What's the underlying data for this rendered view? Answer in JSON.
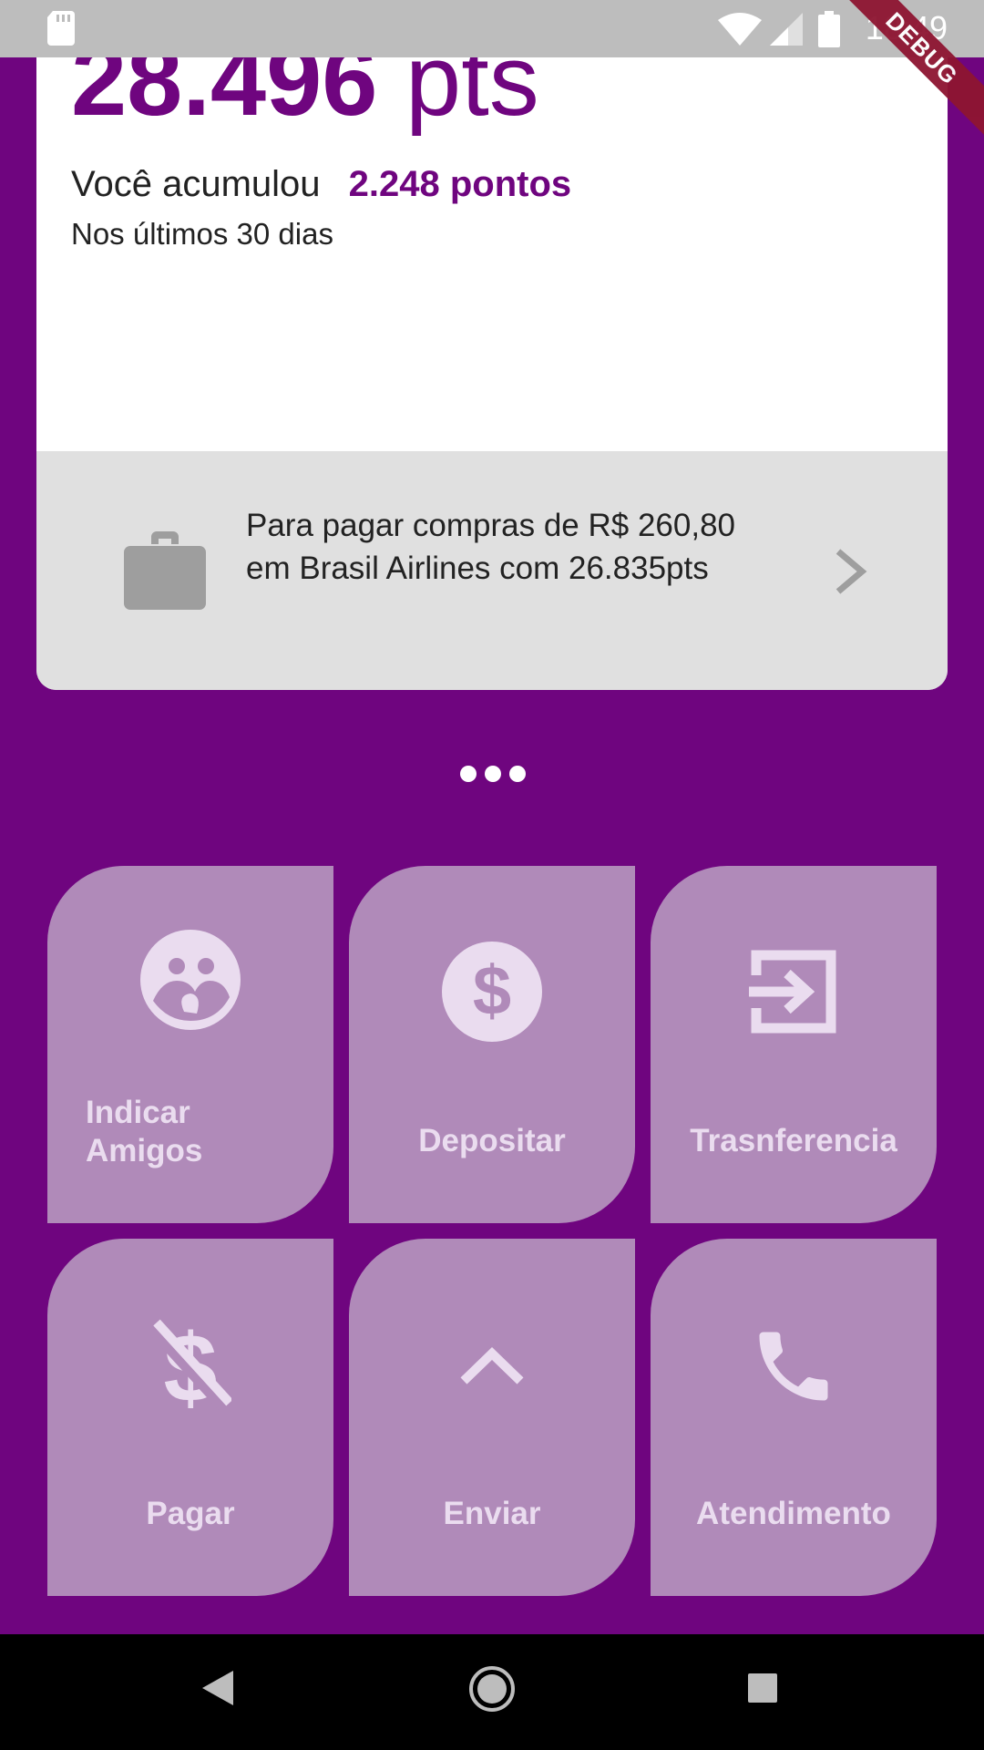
{
  "status_bar": {
    "time": "18:49",
    "debug_label": "DEBUG"
  },
  "summary": {
    "points_value": "28.496",
    "points_unit": "pts",
    "accumulated_prefix": "Você acumulou",
    "accumulated_value": "2.248 pontos",
    "period": "Nos últimos 30 dias"
  },
  "offer": {
    "text": "Para pagar compras de R$ 260,80 em Brasil Airlines com 26.835pts",
    "icon": "briefcase-icon"
  },
  "carousel": {
    "page_count": 3
  },
  "actions": [
    {
      "label": "Indicar Amigos",
      "icon": "group-icon"
    },
    {
      "label": "Depositar",
      "icon": "dollar-circle-icon"
    },
    {
      "label": "Trasnferencia",
      "icon": "transfer-in-icon"
    },
    {
      "label": "Pagar",
      "icon": "no-money-icon"
    },
    {
      "label": "Enviar",
      "icon": "chevron-up-icon"
    },
    {
      "label": "Atendimento",
      "icon": "phone-icon"
    }
  ],
  "colors": {
    "primary": "#6f057f",
    "tile": "#b08ab9",
    "tile_content": "#eadcef"
  }
}
